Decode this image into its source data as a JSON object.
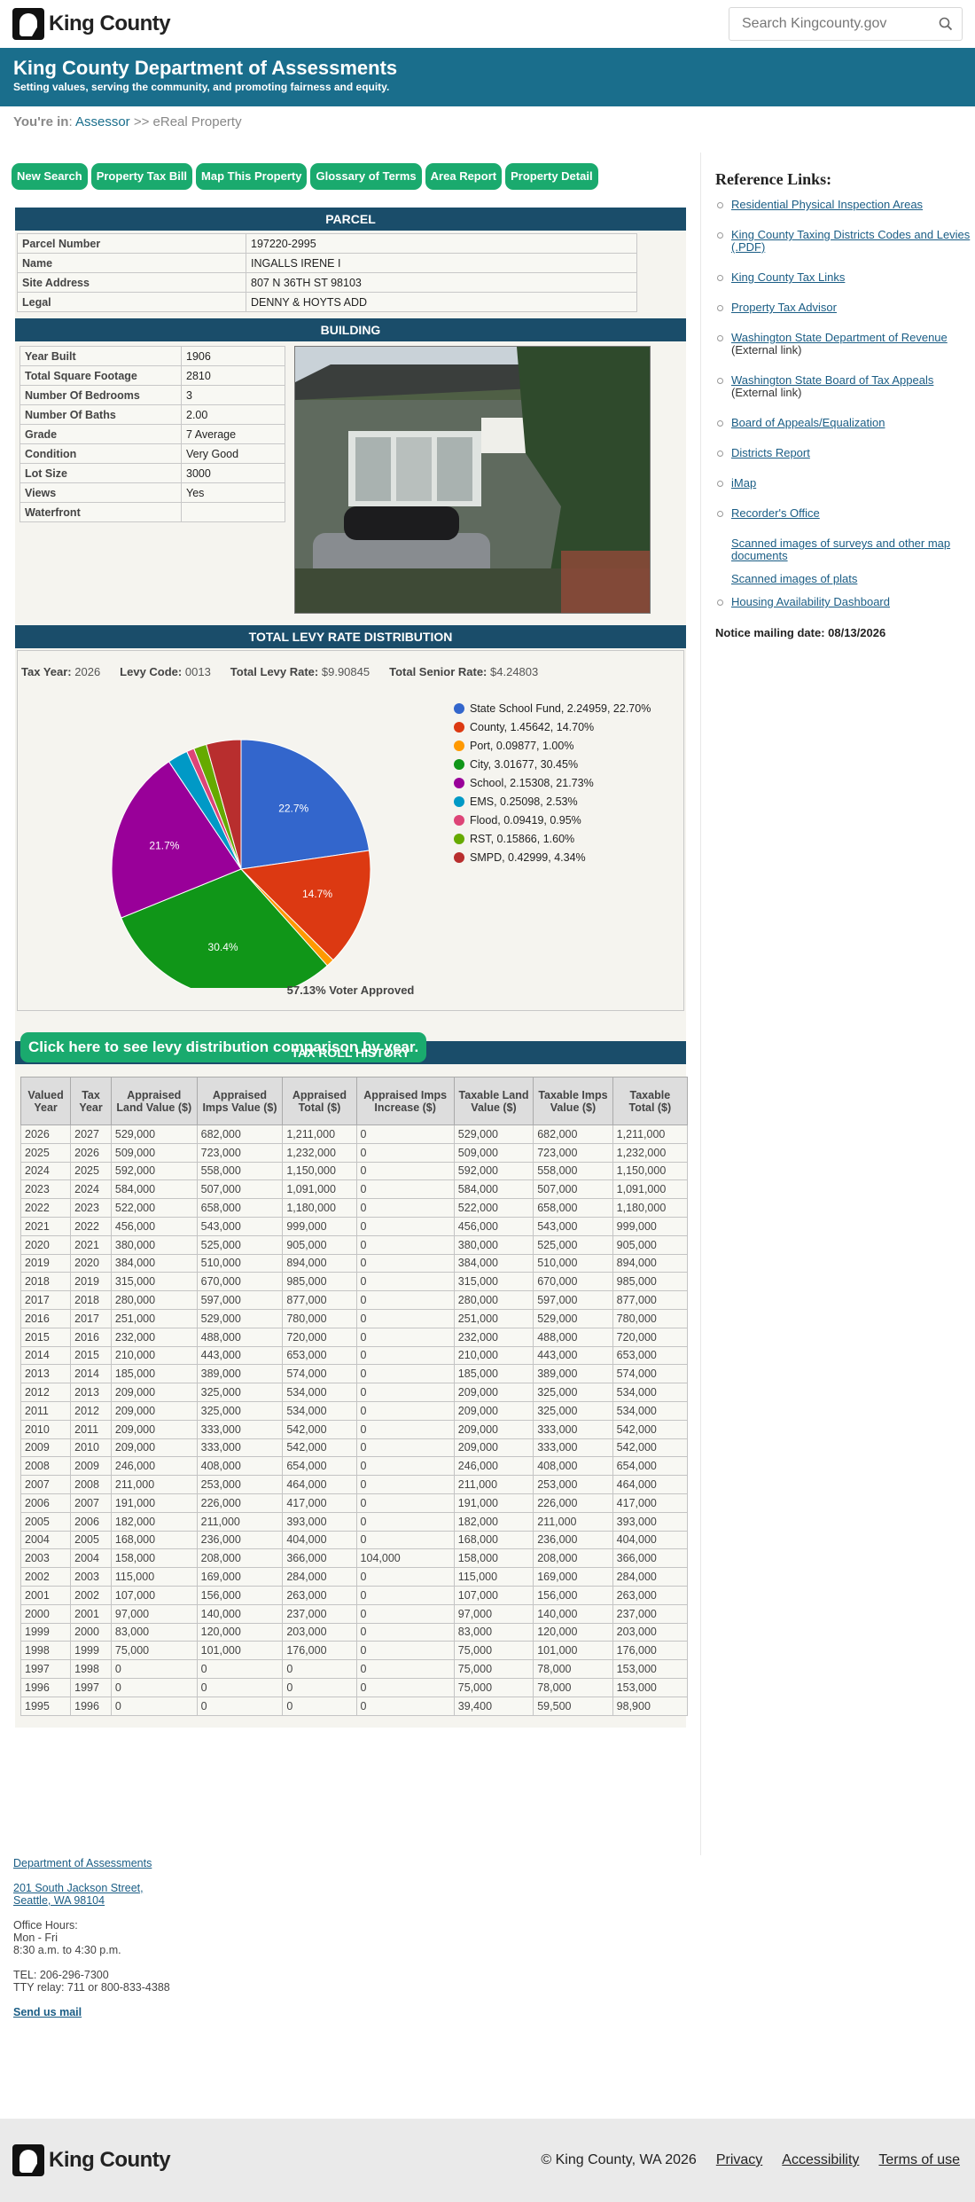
{
  "header": {
    "logo_text": "King County",
    "search_placeholder": "Search Kingcounty.gov"
  },
  "banner": {
    "title": "King County Department of Assessments",
    "subtitle": "Setting values, serving the community, and promoting fairness and equity."
  },
  "breadcrumb": {
    "prefix": "You're in",
    "link": "Assessor",
    "sep": " >> ",
    "current": "eReal Property"
  },
  "buttons": [
    "New Search",
    "Property Tax Bill",
    "Map This Property",
    "Glossary of Terms",
    "Area Report",
    "Property Detail"
  ],
  "parcel": {
    "heading": "PARCEL",
    "rows": [
      {
        "k": "Parcel Number",
        "v": "197220-2995"
      },
      {
        "k": "Name",
        "v": "INGALLS IRENE I"
      },
      {
        "k": "Site Address",
        "v": "807 N 36TH ST 98103"
      },
      {
        "k": "Legal",
        "v": "DENNY & HOYTS ADD"
      }
    ]
  },
  "building": {
    "heading": "BUILDING",
    "rows": [
      {
        "k": "Year Built",
        "v": "1906"
      },
      {
        "k": "Total Square Footage",
        "v": "2810"
      },
      {
        "k": "Number Of Bedrooms",
        "v": "3"
      },
      {
        "k": "Number Of Baths",
        "v": "2.00"
      },
      {
        "k": "Grade",
        "v": "7 Average"
      },
      {
        "k": "Condition",
        "v": "Very Good"
      },
      {
        "k": "Lot Size",
        "v": "3000"
      },
      {
        "k": "Views",
        "v": "Yes"
      },
      {
        "k": "Waterfront",
        "v": ""
      }
    ]
  },
  "levy": {
    "heading": "TOTAL LEVY RATE DISTRIBUTION",
    "tax_year_label": "Tax Year:",
    "tax_year": "2026",
    "levy_code_label": "Levy Code:",
    "levy_code": "0013",
    "total_label": "Total Levy Rate:",
    "total": "$9.90845",
    "senior_label": "Total Senior Rate:",
    "senior": "$4.24803",
    "voter": "57.13% Voter Approved",
    "compare_button": "Click here to see levy distribution comparison by year."
  },
  "chart_data": {
    "type": "pie",
    "slices": [
      {
        "label": "State School Fund, 2.24959, 22.70%",
        "value": 22.7,
        "color": "#3366cc",
        "pct": "22.7%"
      },
      {
        "label": "County, 1.45642, 14.70%",
        "value": 14.7,
        "color": "#dc3912",
        "pct": "14.7%"
      },
      {
        "label": "Port, 0.09877, 1.00%",
        "value": 1.0,
        "color": "#ff9900",
        "pct": ""
      },
      {
        "label": "City, 3.01677, 30.45%",
        "value": 30.45,
        "color": "#109618",
        "pct": "30.4%"
      },
      {
        "label": "School, 2.15308, 21.73%",
        "value": 21.73,
        "color": "#990099",
        "pct": "21.7%"
      },
      {
        "label": "EMS, 0.25098, 2.53%",
        "value": 2.53,
        "color": "#0099c6",
        "pct": ""
      },
      {
        "label": "Flood, 0.09419, 0.95%",
        "value": 0.95,
        "color": "#dd4477",
        "pct": ""
      },
      {
        "label": "RST, 0.15866, 1.60%",
        "value": 1.6,
        "color": "#66aa00",
        "pct": ""
      },
      {
        "label": "SMPD, 0.42999, 4.34%",
        "value": 4.34,
        "color": "#b82e2e",
        "pct": ""
      }
    ]
  },
  "taxroll": {
    "heading": "TAX ROLL HISTORY",
    "columns": [
      "Valued Year",
      "Tax Year",
      "Appraised Land Value ($)",
      "Appraised Imps Value ($)",
      "Appraised Total ($)",
      "Appraised Imps Increase ($)",
      "Taxable Land Value ($)",
      "Taxable Imps Value ($)",
      "Taxable Total ($)"
    ],
    "rows": [
      [
        "2026",
        "2027",
        "529,000",
        "682,000",
        "1,211,000",
        "0",
        "529,000",
        "682,000",
        "1,211,000"
      ],
      [
        "2025",
        "2026",
        "509,000",
        "723,000",
        "1,232,000",
        "0",
        "509,000",
        "723,000",
        "1,232,000"
      ],
      [
        "2024",
        "2025",
        "592,000",
        "558,000",
        "1,150,000",
        "0",
        "592,000",
        "558,000",
        "1,150,000"
      ],
      [
        "2023",
        "2024",
        "584,000",
        "507,000",
        "1,091,000",
        "0",
        "584,000",
        "507,000",
        "1,091,000"
      ],
      [
        "2022",
        "2023",
        "522,000",
        "658,000",
        "1,180,000",
        "0",
        "522,000",
        "658,000",
        "1,180,000"
      ],
      [
        "2021",
        "2022",
        "456,000",
        "543,000",
        "999,000",
        "0",
        "456,000",
        "543,000",
        "999,000"
      ],
      [
        "2020",
        "2021",
        "380,000",
        "525,000",
        "905,000",
        "0",
        "380,000",
        "525,000",
        "905,000"
      ],
      [
        "2019",
        "2020",
        "384,000",
        "510,000",
        "894,000",
        "0",
        "384,000",
        "510,000",
        "894,000"
      ],
      [
        "2018",
        "2019",
        "315,000",
        "670,000",
        "985,000",
        "0",
        "315,000",
        "670,000",
        "985,000"
      ],
      [
        "2017",
        "2018",
        "280,000",
        "597,000",
        "877,000",
        "0",
        "280,000",
        "597,000",
        "877,000"
      ],
      [
        "2016",
        "2017",
        "251,000",
        "529,000",
        "780,000",
        "0",
        "251,000",
        "529,000",
        "780,000"
      ],
      [
        "2015",
        "2016",
        "232,000",
        "488,000",
        "720,000",
        "0",
        "232,000",
        "488,000",
        "720,000"
      ],
      [
        "2014",
        "2015",
        "210,000",
        "443,000",
        "653,000",
        "0",
        "210,000",
        "443,000",
        "653,000"
      ],
      [
        "2013",
        "2014",
        "185,000",
        "389,000",
        "574,000",
        "0",
        "185,000",
        "389,000",
        "574,000"
      ],
      [
        "2012",
        "2013",
        "209,000",
        "325,000",
        "534,000",
        "0",
        "209,000",
        "325,000",
        "534,000"
      ],
      [
        "2011",
        "2012",
        "209,000",
        "325,000",
        "534,000",
        "0",
        "209,000",
        "325,000",
        "534,000"
      ],
      [
        "2010",
        "2011",
        "209,000",
        "333,000",
        "542,000",
        "0",
        "209,000",
        "333,000",
        "542,000"
      ],
      [
        "2009",
        "2010",
        "209,000",
        "333,000",
        "542,000",
        "0",
        "209,000",
        "333,000",
        "542,000"
      ],
      [
        "2008",
        "2009",
        "246,000",
        "408,000",
        "654,000",
        "0",
        "246,000",
        "408,000",
        "654,000"
      ],
      [
        "2007",
        "2008",
        "211,000",
        "253,000",
        "464,000",
        "0",
        "211,000",
        "253,000",
        "464,000"
      ],
      [
        "2006",
        "2007",
        "191,000",
        "226,000",
        "417,000",
        "0",
        "191,000",
        "226,000",
        "417,000"
      ],
      [
        "2005",
        "2006",
        "182,000",
        "211,000",
        "393,000",
        "0",
        "182,000",
        "211,000",
        "393,000"
      ],
      [
        "2004",
        "2005",
        "168,000",
        "236,000",
        "404,000",
        "0",
        "168,000",
        "236,000",
        "404,000"
      ],
      [
        "2003",
        "2004",
        "158,000",
        "208,000",
        "366,000",
        "104,000",
        "158,000",
        "208,000",
        "366,000"
      ],
      [
        "2002",
        "2003",
        "115,000",
        "169,000",
        "284,000",
        "0",
        "115,000",
        "169,000",
        "284,000"
      ],
      [
        "2001",
        "2002",
        "107,000",
        "156,000",
        "263,000",
        "0",
        "107,000",
        "156,000",
        "263,000"
      ],
      [
        "2000",
        "2001",
        "97,000",
        "140,000",
        "237,000",
        "0",
        "97,000",
        "140,000",
        "237,000"
      ],
      [
        "1999",
        "2000",
        "83,000",
        "120,000",
        "203,000",
        "0",
        "83,000",
        "120,000",
        "203,000"
      ],
      [
        "1998",
        "1999",
        "75,000",
        "101,000",
        "176,000",
        "0",
        "75,000",
        "101,000",
        "176,000"
      ],
      [
        "1997",
        "1998",
        "0",
        "0",
        "0",
        "0",
        "75,000",
        "78,000",
        "153,000"
      ],
      [
        "1996",
        "1997",
        "0",
        "0",
        "0",
        "0",
        "75,000",
        "78,000",
        "153,000"
      ],
      [
        "1995",
        "1996",
        "0",
        "0",
        "0",
        "0",
        "39,400",
        "59,500",
        "98,900"
      ]
    ]
  },
  "reference": {
    "title": "Reference Links:",
    "links": [
      {
        "text": "Residential Physical Inspection Areas",
        "ext": ""
      },
      {
        "text": "King County Taxing Districts Codes and Levies (.PDF)",
        "ext": ""
      },
      {
        "text": "King County Tax Links",
        "ext": ""
      },
      {
        "text": "Property Tax Advisor",
        "ext": ""
      },
      {
        "text": "Washington State Department of Revenue",
        "ext": " (External link)"
      },
      {
        "text": "Washington State Board of Tax Appeals",
        "ext": " (External link)"
      },
      {
        "text": "Board of Appeals/Equalization",
        "ext": ""
      },
      {
        "text": "Districts Report",
        "ext": ""
      },
      {
        "text": "iMap",
        "ext": ""
      },
      {
        "text": "Recorder's Office",
        "ext": ""
      }
    ],
    "plain_links": [
      "Scanned images of surveys and other map documents",
      "Scanned images of plats"
    ],
    "last_link": "Housing Availability Dashboard",
    "notice": "Notice mailing date: 08/13/2026"
  },
  "footer": {
    "dept": "Department of Assessments",
    "addr1": "201 South Jackson Street,",
    "addr2": "Seattle, WA 98104",
    "hours_label": "Office Hours:",
    "days": "Mon - Fri",
    "hours": "8:30 a.m. to 4:30 p.m.",
    "tel": "TEL: 206-296-7300",
    "tty": "TTY relay: 711 or 800-833-4388",
    "mail": "Send us mail",
    "copyright": "© King County, WA 2026",
    "links": [
      "Privacy",
      "Accessibility",
      "Terms of use"
    ]
  }
}
